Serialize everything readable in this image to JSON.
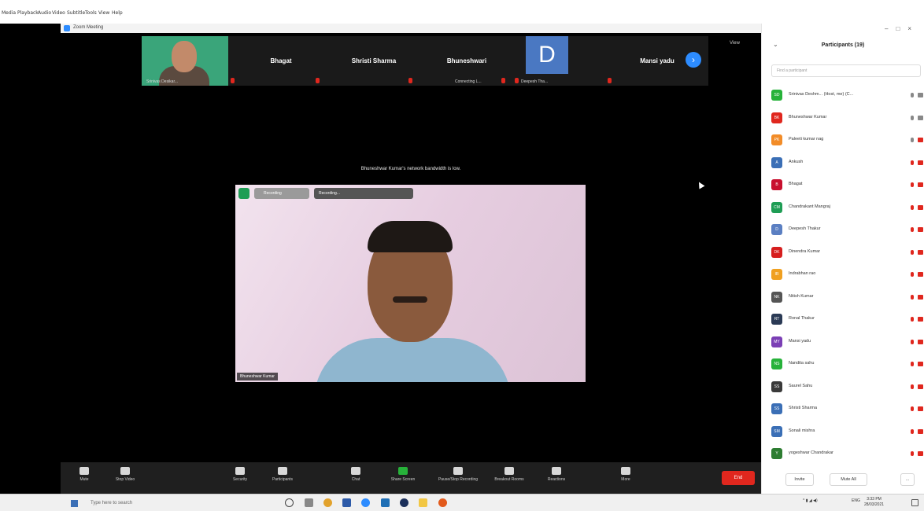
{
  "player_menu": [
    "Media",
    "Playback",
    "Audio",
    "Video",
    "Subtitle",
    "Tools",
    "View",
    "Help"
  ],
  "zoom_window_title": "Zoom Meeting",
  "gallery_strip": {
    "tiles": [
      {
        "name": "",
        "sub": "Srinivas Desikar..."
      },
      {
        "name": "Bhagat",
        "sub": ""
      },
      {
        "name": "Shristi Sharma",
        "sub": ""
      },
      {
        "name": "Bhuneshwari",
        "sub": "Connecting L..."
      },
      {
        "name": "",
        "sub": "Deepesh Tha..."
      },
      {
        "name": "Mansi yadu",
        "sub": ""
      }
    ],
    "avatar_letter": "D",
    "view_label": "View"
  },
  "bandwidth_message": "Bhuneshwar Kumar's network bandwidth is low.",
  "active_video": {
    "recording_label": "Recording",
    "recording_status": "Recording...",
    "name_tag": "Bhuneshwar Kumar"
  },
  "controls": {
    "mute": "Mute",
    "stop_video": "Stop Video",
    "security": "Security",
    "participants": "Participants",
    "participants_count": "19",
    "chat": "Chat",
    "share_screen": "Share Screen",
    "pause_recording": "Pause/Stop Recording",
    "breakout_rooms": "Breakout Rooms",
    "reactions": "Reactions",
    "more": "More",
    "end": "End"
  },
  "participants_panel": {
    "title": "Participants (19)",
    "search_placeholder": "Find a participant",
    "footer": {
      "invite": "Invite",
      "mute_all": "Mute All",
      "more": "..."
    },
    "list": [
      {
        "initials": "SD",
        "name": "Srinivas Deshm... (Host, me) (C...",
        "color": "#27b23a",
        "mic_on": true,
        "cam_on": true
      },
      {
        "initials": "BK",
        "name": "Bhuneshwar Kumar",
        "color": "#e0271e",
        "mic_on": true,
        "cam_on": true
      },
      {
        "initials": "PK",
        "name": "Paleeti kumar nag",
        "color": "#f28c28",
        "mic_on": true,
        "cam_on": false
      },
      {
        "initials": "A",
        "name": "Ankush",
        "color": "#3b6fb6",
        "mic_on": false,
        "cam_on": false
      },
      {
        "initials": "B",
        "name": "Bhagat",
        "color": "#c8102e",
        "mic_on": false,
        "cam_on": false
      },
      {
        "initials": "CM",
        "name": "Chandrakant Mangraj",
        "color": "#1f9d55",
        "mic_on": false,
        "cam_on": false
      },
      {
        "initials": "D",
        "name": "Deepesh Thakur",
        "color": "#5b7fc2",
        "mic_on": false,
        "cam_on": false
      },
      {
        "initials": "DK",
        "name": "Dinendra Kumar",
        "color": "#d61f1f",
        "mic_on": false,
        "cam_on": false
      },
      {
        "initials": "IR",
        "name": "Indrabhan rao",
        "color": "#f0a020",
        "mic_on": false,
        "cam_on": false
      },
      {
        "initials": "NK",
        "name": "Nitish Kumar",
        "color": "#555555",
        "mic_on": false,
        "cam_on": false
      },
      {
        "initials": "RT",
        "name": "Ronal Thakur",
        "color": "#2b3a55",
        "mic_on": false,
        "cam_on": false
      },
      {
        "initials": "MY",
        "name": "Mansi yadu",
        "color": "#7b3fb5",
        "mic_on": false,
        "cam_on": false
      },
      {
        "initials": "NS",
        "name": "Nandita sahu",
        "color": "#27b23a",
        "mic_on": false,
        "cam_on": false
      },
      {
        "initials": "SS",
        "name": "Saurel Sahu",
        "color": "#3a3a3a",
        "mic_on": false,
        "cam_on": false
      },
      {
        "initials": "SS",
        "name": "Shristi Sharma",
        "color": "#3b6fb6",
        "mic_on": false,
        "cam_on": false
      },
      {
        "initials": "SM",
        "name": "Sonali mishra",
        "color": "#3b6fb6",
        "mic_on": false,
        "cam_on": false
      },
      {
        "initials": "Y",
        "name": "yogeshwar Chandrakar",
        "color": "#2e7d32",
        "mic_on": false,
        "cam_on": false
      }
    ]
  },
  "taskbar": {
    "search_text": "Type here to search",
    "tray_lang": "ENG",
    "time": "3:33 PM",
    "date": "28/03/2021"
  }
}
